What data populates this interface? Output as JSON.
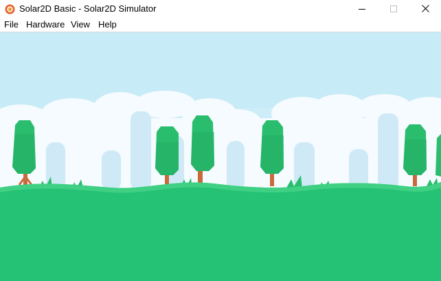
{
  "window": {
    "title": "Solar2D Basic - Solar2D Simulator",
    "controls": {
      "minimize": "minimize-icon",
      "maximize": "maximize-icon",
      "close": "close-icon"
    }
  },
  "menubar": {
    "items": [
      {
        "label": "File"
      },
      {
        "label": "Hardware"
      },
      {
        "label": "View"
      },
      {
        "label": "Help"
      }
    ]
  },
  "scene": {
    "sky_color": "#cdeef8",
    "cloud_color": "#ffffff",
    "far_tree_color": "#bfe3f2",
    "tree_color": "#2bbd6e",
    "tree_dark_color": "#1ea05a",
    "trunk_color": "#c86a3c",
    "ground_color": "#25c174",
    "ground_top_color": "#3fd083"
  }
}
